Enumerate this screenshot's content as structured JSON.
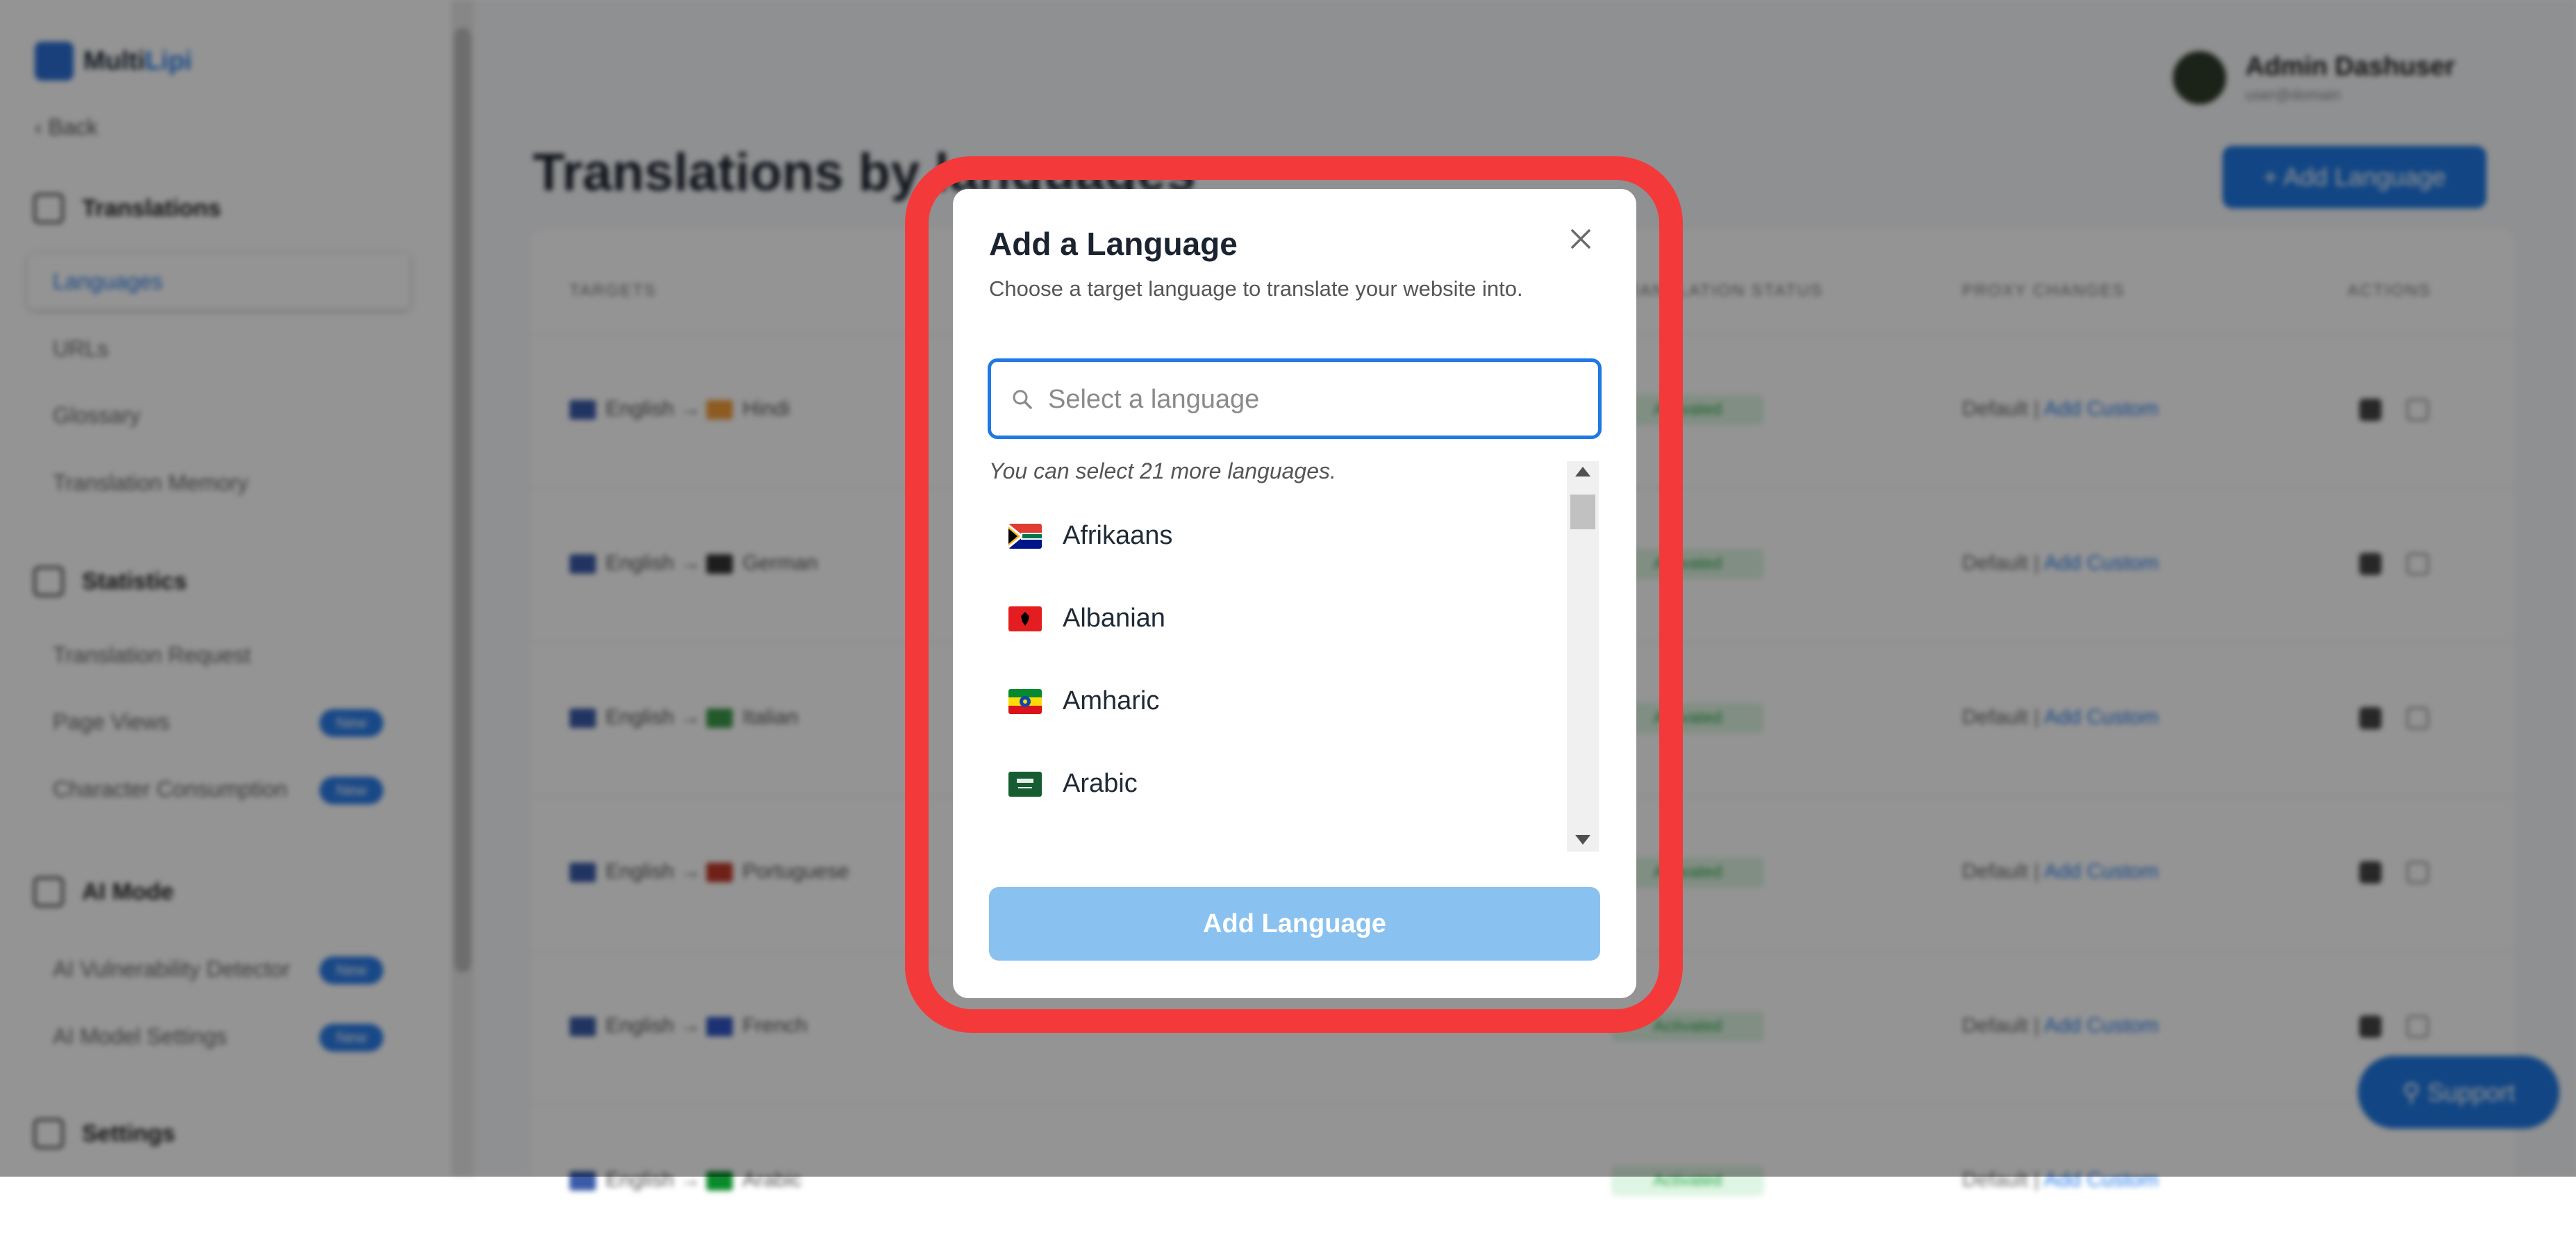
{
  "app": {
    "logo": {
      "part1": "Multi",
      "part2": "Lipi"
    },
    "back_label": "Back",
    "sidebar": {
      "sections": [
        {
          "label": "Translations",
          "items": [
            {
              "label": "Languages",
              "active": true
            },
            {
              "label": "URLs"
            },
            {
              "label": "Glossary"
            },
            {
              "label": "Translation Memory"
            }
          ]
        },
        {
          "label": "Statistics",
          "items": [
            {
              "label": "Translation Request"
            },
            {
              "label": "Page Views",
              "badge": "New"
            },
            {
              "label": "Character Consumption",
              "badge": "New"
            }
          ]
        },
        {
          "label": "AI Mode",
          "items": [
            {
              "label": "AI Vulnerability Detector",
              "badge": "New"
            },
            {
              "label": "AI Model Settings",
              "badge": "New"
            }
          ]
        },
        {
          "label": "Settings",
          "items": []
        }
      ]
    },
    "user": {
      "name": "Admin Dashuser",
      "email": "user@domain"
    },
    "page_title": "Translations by languages",
    "add_language_top": "+ Add Language",
    "table": {
      "headers": [
        "TARGETS",
        "TRANSLATION STATUS",
        "PROXY CHANGES",
        "ACTIONS"
      ],
      "rows": [
        {
          "source": "English",
          "target": "Hindi",
          "status": "Activated",
          "proxy": "Default",
          "proxy_link": "Add Custom"
        },
        {
          "source": "English",
          "target": "German",
          "status": "Activated",
          "proxy": "Default",
          "proxy_link": "Add Custom"
        },
        {
          "source": "English",
          "target": "Italian",
          "status": "Activated",
          "proxy": "Default",
          "proxy_link": "Add Custom"
        },
        {
          "source": "English",
          "target": "Portuguese",
          "status": "Activated",
          "proxy": "Default",
          "proxy_link": "Add Custom"
        },
        {
          "source": "English",
          "target": "French",
          "status": "Activated",
          "proxy": "Default",
          "proxy_link": "Add Custom"
        },
        {
          "source": "English",
          "target": "Arabic",
          "status": "Activated",
          "proxy": "Default",
          "proxy_link": "Add Custom"
        }
      ]
    },
    "support_label": "Support"
  },
  "modal": {
    "title": "Add a Language",
    "subtitle": "Choose a target language to translate your website into.",
    "search_placeholder": "Select a language",
    "search_value": "",
    "hint": "You can select 21 more languages.",
    "languages": [
      {
        "name": "Afrikaans",
        "flag_icon": "south-africa-flag-icon"
      },
      {
        "name": "Albanian",
        "flag_icon": "albania-flag-icon"
      },
      {
        "name": "Amharic",
        "flag_icon": "ethiopia-flag-icon"
      },
      {
        "name": "Arabic",
        "flag_icon": "saudi-arabia-flag-icon"
      }
    ],
    "submit_label": "Add Language",
    "submit_enabled": false,
    "colors": {
      "frame": "#f4393b",
      "accent": "#1f78e3",
      "button_disabled": "#89c2f0"
    }
  }
}
